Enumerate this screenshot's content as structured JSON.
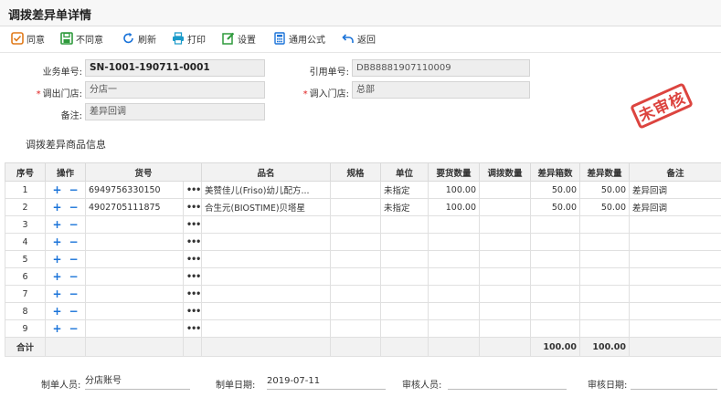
{
  "page": {
    "title": "调拨差异单详情"
  },
  "toolbar": [
    {
      "label": "同意",
      "icon": "check-square-icon"
    },
    {
      "label": "不同意",
      "icon": "save-icon"
    },
    {
      "label": "刷新",
      "icon": "refresh-icon"
    },
    {
      "label": "打印",
      "icon": "print-icon"
    },
    {
      "label": "设置",
      "icon": "edit-icon"
    },
    {
      "label": "通用公式",
      "icon": "calculator-icon"
    },
    {
      "label": "返回",
      "icon": "return-icon"
    }
  ],
  "form": {
    "order_no_label": "业务单号:",
    "order_no": "SN-1001-190711-0001",
    "ref_no_label": "引用单号:",
    "ref_no": "DB88881907110009",
    "out_store_label": "调出门店:",
    "out_store": "分店一",
    "in_store_label": "调入门店:",
    "in_store": "总部",
    "remark_label": "备注:",
    "remark": "差异回调"
  },
  "stamp": "未审核",
  "section_title": "调拨差异商品信息",
  "table": {
    "headers": [
      "序号",
      "操作",
      "货号",
      "",
      "品名",
      "规格",
      "单位",
      "要货数量",
      "调拨数量",
      "差异箱数",
      "差异数量",
      "备注"
    ],
    "ops": {
      "add": "+",
      "remove": "−",
      "more": "•••"
    },
    "rows": [
      {
        "no": "1",
        "code": "6949756330150",
        "name": "美赞佳儿(Friso)幼儿配方...",
        "spec": "",
        "unit": "未指定",
        "req_qty": "100.00",
        "tr_qty": "",
        "diff_box": "50.00",
        "diff_qty": "50.00",
        "note": "差异回调"
      },
      {
        "no": "2",
        "code": "4902705111875",
        "name": "合生元(BIOSTIME)贝塔星",
        "spec": "",
        "unit": "未指定",
        "req_qty": "100.00",
        "tr_qty": "",
        "diff_box": "50.00",
        "diff_qty": "50.00",
        "note": "差异回调"
      },
      {
        "no": "3",
        "code": "",
        "name": "",
        "spec": "",
        "unit": "",
        "req_qty": "",
        "tr_qty": "",
        "diff_box": "",
        "diff_qty": "",
        "note": ""
      },
      {
        "no": "4",
        "code": "",
        "name": "",
        "spec": "",
        "unit": "",
        "req_qty": "",
        "tr_qty": "",
        "diff_box": "",
        "diff_qty": "",
        "note": ""
      },
      {
        "no": "5",
        "code": "",
        "name": "",
        "spec": "",
        "unit": "",
        "req_qty": "",
        "tr_qty": "",
        "diff_box": "",
        "diff_qty": "",
        "note": ""
      },
      {
        "no": "6",
        "code": "",
        "name": "",
        "spec": "",
        "unit": "",
        "req_qty": "",
        "tr_qty": "",
        "diff_box": "",
        "diff_qty": "",
        "note": ""
      },
      {
        "no": "7",
        "code": "",
        "name": "",
        "spec": "",
        "unit": "",
        "req_qty": "",
        "tr_qty": "",
        "diff_box": "",
        "diff_qty": "",
        "note": ""
      },
      {
        "no": "8",
        "code": "",
        "name": "",
        "spec": "",
        "unit": "",
        "req_qty": "",
        "tr_qty": "",
        "diff_box": "",
        "diff_qty": "",
        "note": ""
      },
      {
        "no": "9",
        "code": "",
        "name": "",
        "spec": "",
        "unit": "",
        "req_qty": "",
        "tr_qty": "",
        "diff_box": "",
        "diff_qty": "",
        "note": ""
      }
    ],
    "total": {
      "label": "合计",
      "diff_box": "100.00",
      "diff_qty": "100.00"
    }
  },
  "footer": {
    "maker_label": "制单人员:",
    "maker": "分店账号",
    "make_date_label": "制单日期:",
    "make_date": "2019-07-11",
    "auditor_label": "审核人员:",
    "auditor": "",
    "audit_date_label": "审核日期:",
    "audit_date": ""
  },
  "colors": {
    "accent": "#1a73d9",
    "stamp": "#d9302b",
    "header_bg": "#f2f2f2"
  }
}
